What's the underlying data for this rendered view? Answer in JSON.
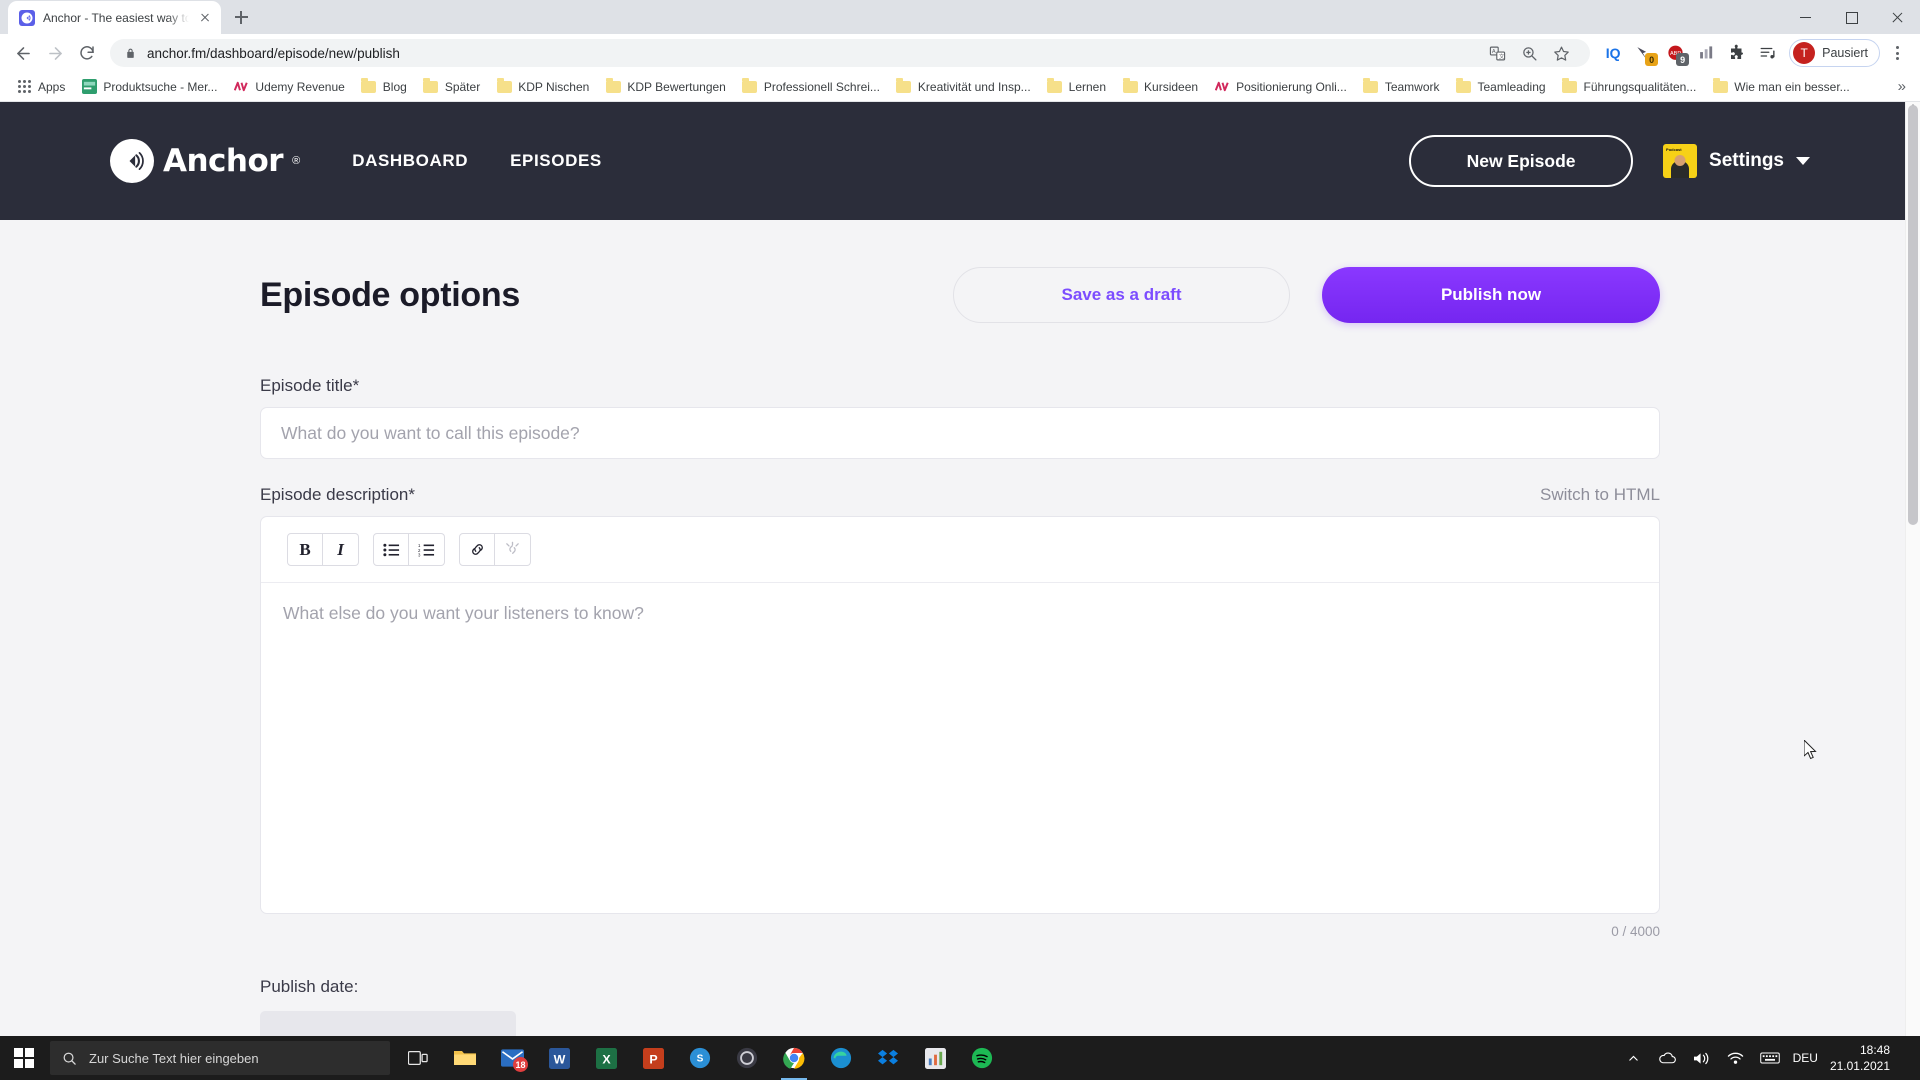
{
  "browser": {
    "tab": {
      "title": "Anchor - The easiest way to mak",
      "favicon": "anchor-icon",
      "close": "close-icon"
    },
    "new_tab_label": "+",
    "window_controls": {
      "minimize": "minimize-icon",
      "maximize": "maximize-icon",
      "close": "close-icon"
    },
    "nav": {
      "back": "back-arrow-icon",
      "forward": "forward-arrow-icon",
      "reload": "reload-icon"
    },
    "omnibox": {
      "url": "anchor.fm/dashboard/episode/new/publish",
      "lock": "lock-icon",
      "translate": "translate-icon",
      "zoom": "zoom-search-icon",
      "bookmark": "star-icon"
    },
    "extensions": [
      {
        "name": "iq-extension",
        "label": "IQ"
      },
      {
        "name": "pocket-extension",
        "badge": "0",
        "badge_color": "#e8a317"
      },
      {
        "name": "adblock-extension",
        "label": "ABP",
        "badge": "9",
        "badge_color": "#5f6368"
      },
      {
        "name": "grid-extension"
      },
      {
        "name": "puzzle-extensions-icon"
      },
      {
        "name": "reading-list-icon"
      }
    ],
    "profile": {
      "initial": "T",
      "status": "Pausiert"
    },
    "menu": "kebab-menu-icon",
    "bookmarks": [
      {
        "label": "Apps",
        "icon": "apps-grid-icon"
      },
      {
        "label": "Produktsuche - Mer...",
        "icon": "site-icon"
      },
      {
        "label": "Udemy Revenue",
        "icon": "udemy-icon"
      },
      {
        "label": "Blog",
        "icon": "folder-icon"
      },
      {
        "label": "Später",
        "icon": "folder-icon"
      },
      {
        "label": "KDP Nischen",
        "icon": "folder-icon"
      },
      {
        "label": "KDP Bewertungen",
        "icon": "folder-icon"
      },
      {
        "label": "Professionell Schrei...",
        "icon": "folder-icon"
      },
      {
        "label": "Kreativität und Insp...",
        "icon": "folder-icon"
      },
      {
        "label": "Lernen",
        "icon": "folder-icon"
      },
      {
        "label": "Kursideen",
        "icon": "folder-icon"
      },
      {
        "label": "Positionierung Onli...",
        "icon": "udemy-icon"
      },
      {
        "label": "Teamwork",
        "icon": "folder-icon"
      },
      {
        "label": "Teamleading",
        "icon": "folder-icon"
      },
      {
        "label": "Führungsqualitäten...",
        "icon": "folder-icon"
      },
      {
        "label": "Wie man ein besser...",
        "icon": "folder-icon"
      }
    ],
    "bookmarks_overflow": "»"
  },
  "site_header": {
    "brand": "Anchor",
    "brand_reg": "®",
    "nav": [
      {
        "label": "DASHBOARD"
      },
      {
        "label": "EPISODES"
      }
    ],
    "new_episode_button": "New Episode",
    "settings_label": "Settings",
    "avatar_text": "Podcast"
  },
  "main": {
    "page_title": "Episode options",
    "save_draft_button": "Save as a draft",
    "publish_button": "Publish now",
    "episode_title": {
      "label": "Episode title*",
      "value": "",
      "placeholder": "What do you want to call this episode?"
    },
    "episode_description": {
      "label": "Episode description*",
      "switch_html": "Switch to HTML",
      "value": "",
      "placeholder": "What else do you want your listeners to know?",
      "char_count": "0 / 4000",
      "toolbar": [
        {
          "name": "bold-button",
          "glyph": "B"
        },
        {
          "name": "italic-button",
          "glyph": "I"
        },
        {
          "name": "bullet-list-button",
          "glyph": "bullet-list-icon"
        },
        {
          "name": "numbered-list-button",
          "glyph": "numbered-list-icon"
        },
        {
          "name": "insert-link-button",
          "glyph": "link-icon"
        },
        {
          "name": "remove-link-button",
          "glyph": "unlink-icon"
        }
      ]
    },
    "publish_date_label": "Publish date:"
  },
  "colors": {
    "accent_purple": "#7b2ff7",
    "header_dark": "#2b2d3a",
    "page_bg": "#f4f4f6"
  },
  "taskbar": {
    "start": "windows-start-icon",
    "search_placeholder": "Zur Suche Text hier eingeben",
    "task_view": "task-view-icon",
    "apps": [
      {
        "name": "file-explorer-icon"
      },
      {
        "name": "mail-icon",
        "badge": "18"
      },
      {
        "name": "word-icon",
        "label": "W"
      },
      {
        "name": "excel-icon",
        "label": "X"
      },
      {
        "name": "powerpoint-icon",
        "label": "P"
      },
      {
        "name": "skype-icon"
      },
      {
        "name": "obs-icon"
      },
      {
        "name": "chrome-icon"
      },
      {
        "name": "edge-icon"
      },
      {
        "name": "dropbox-icon"
      },
      {
        "name": "charts-app-icon"
      },
      {
        "name": "spotify-icon"
      }
    ],
    "tray": {
      "expand": "chevron-up-icon",
      "onedrive": "cloud-icon",
      "volume": "speaker-icon",
      "network": "wifi-icon",
      "keyboard": "keyboard-icon",
      "language": "DEU",
      "time": "18:48",
      "date": "21.01.2021"
    }
  }
}
